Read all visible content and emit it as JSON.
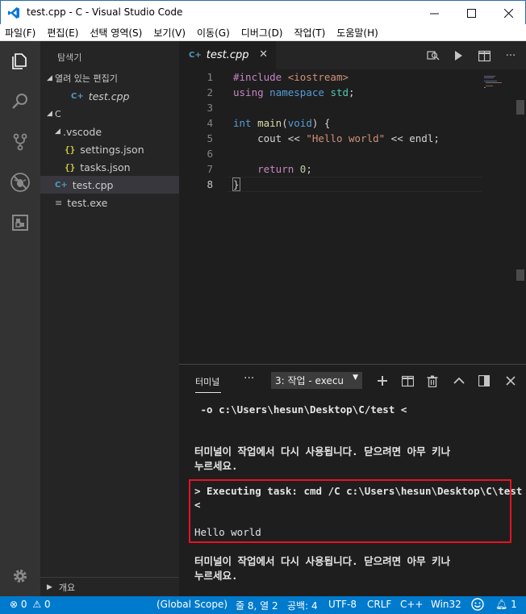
{
  "window": {
    "title": "test.cpp - C - Visual Studio Code"
  },
  "menu": [
    "파일(F)",
    "편집(E)",
    "선택 영역(S)",
    "보기(V)",
    "이동(G)",
    "디버그(D)",
    "작업(T)",
    "도움말(H)"
  ],
  "sidebar": {
    "title": "탐색기",
    "open_editors_label": "열려 있는 편집기",
    "open_editor_file": "test.cpp",
    "folder_label": "C",
    "vscode_folder": ".vscode",
    "files": [
      "settings.json",
      "tasks.json",
      "test.cpp",
      "test.exe"
    ],
    "outline_label": "개요"
  },
  "editor": {
    "tab_label": "test.cpp",
    "line_numbers": [
      "1",
      "2",
      "3",
      "4",
      "5",
      "6",
      "7",
      "8"
    ]
  },
  "code": {
    "l1a": "#include ",
    "l1b": "<iostream>",
    "l2a": "using",
    "l2b": " namespace ",
    "l2c": "std",
    "l2d": ";",
    "l4a": "int",
    "l4b": " main",
    "l4c": "(",
    "l4d": "void",
    "l4e": ") {",
    "l5a": "    cout << ",
    "l5b": "\"Hello world\"",
    "l5c": " << endl;",
    "l7a": "    return ",
    "l7b": "0",
    "l7c": ";",
    "l8": "}"
  },
  "panel": {
    "tab": "터미널",
    "more": "···",
    "terminal_select": "3: 작업 - execu"
  },
  "terminal": {
    "line1": " -o c:\\Users\\hesun\\Desktop\\C/test <",
    "line2": "터미널이 작업에서 다시 사용됩니다. 닫으려면 아무 키나",
    "line3": "누르세요.",
    "line4": "> Executing task: cmd /C c:\\Users\\hesun\\Desktop\\C\\test",
    "line5": "<",
    "line6": "Hello world",
    "line7": "터미널이 작업에서 다시 사용됩니다. 닫으려면 아무 키나",
    "line8": "누르세요."
  },
  "status": {
    "errors": "0",
    "warnings": "0",
    "scope": "(Global Scope)",
    "position": "줄 8, 열 2",
    "spaces": "공백: 4",
    "encoding": "UTF-8",
    "eol": "CRLF",
    "language": "C++",
    "platform": "Win32",
    "notifications": "1"
  },
  "colors": {
    "statusbar": "#007acc",
    "activitybar": "#333333",
    "sidebar": "#252526",
    "editor": "#1e1e1e",
    "highlight_box": "#e81123"
  }
}
